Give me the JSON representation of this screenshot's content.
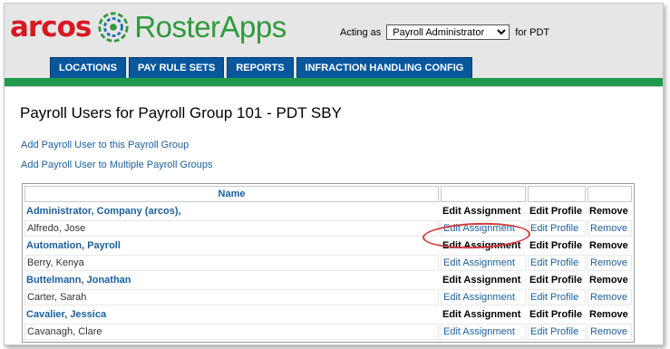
{
  "brand": {
    "arcos": "arcos",
    "product": "RosterApps"
  },
  "acting": {
    "prefix": "Acting as",
    "role": "Payroll Administrator",
    "suffix": "for PDT"
  },
  "nav": {
    "tabs": [
      "LOCATIONS",
      "PAY RULE SETS",
      "REPORTS",
      "INFRACTION HANDLING CONFIG"
    ]
  },
  "page": {
    "title": "Payroll Users for Payroll Group 101 - PDT SBY",
    "add_link": "Add Payroll User to this Payroll Group",
    "add_multi_link": "Add Payroll User to Multiple Payroll Groups"
  },
  "table": {
    "header": "Name",
    "rows": [
      {
        "name": "Administrator, Company (arcos),",
        "edit_assignment": "Edit Assignment",
        "edit_profile": "Edit Profile",
        "remove": "Remove"
      },
      {
        "name": "Alfredo, Jose",
        "edit_assignment": "Edit Assignment",
        "edit_profile": "Edit Profile",
        "remove": "Remove"
      },
      {
        "name": "Automation, Payroll",
        "edit_assignment": "Edit Assignment",
        "edit_profile": "Edit Profile",
        "remove": "Remove"
      },
      {
        "name": "Berry, Kenya",
        "edit_assignment": "Edit Assignment",
        "edit_profile": "Edit Profile",
        "remove": "Remove"
      },
      {
        "name": "Buttelmann, Jonathan",
        "edit_assignment": "Edit Assignment",
        "edit_profile": "Edit Profile",
        "remove": "Remove"
      },
      {
        "name": "Carter, Sarah",
        "edit_assignment": "Edit Assignment",
        "edit_profile": "Edit Profile",
        "remove": "Remove"
      },
      {
        "name": "Cavalier, Jessica",
        "edit_assignment": "Edit Assignment",
        "edit_profile": "Edit Profile",
        "remove": "Remove"
      },
      {
        "name": "Cavanagh, Clare",
        "edit_assignment": "Edit Assignment",
        "edit_profile": "Edit Profile",
        "remove": "Remove"
      }
    ]
  },
  "colors": {
    "brand_red": "#d71920",
    "brand_green": "#2e9a3c",
    "tab_blue": "#07579d",
    "link_blue": "#1a5f9e",
    "bar_green": "#1f9a4a",
    "highlight_red": "#d43c3c"
  },
  "icons": {
    "logo_mark": "arcos-rosterapps-logo-mark"
  }
}
